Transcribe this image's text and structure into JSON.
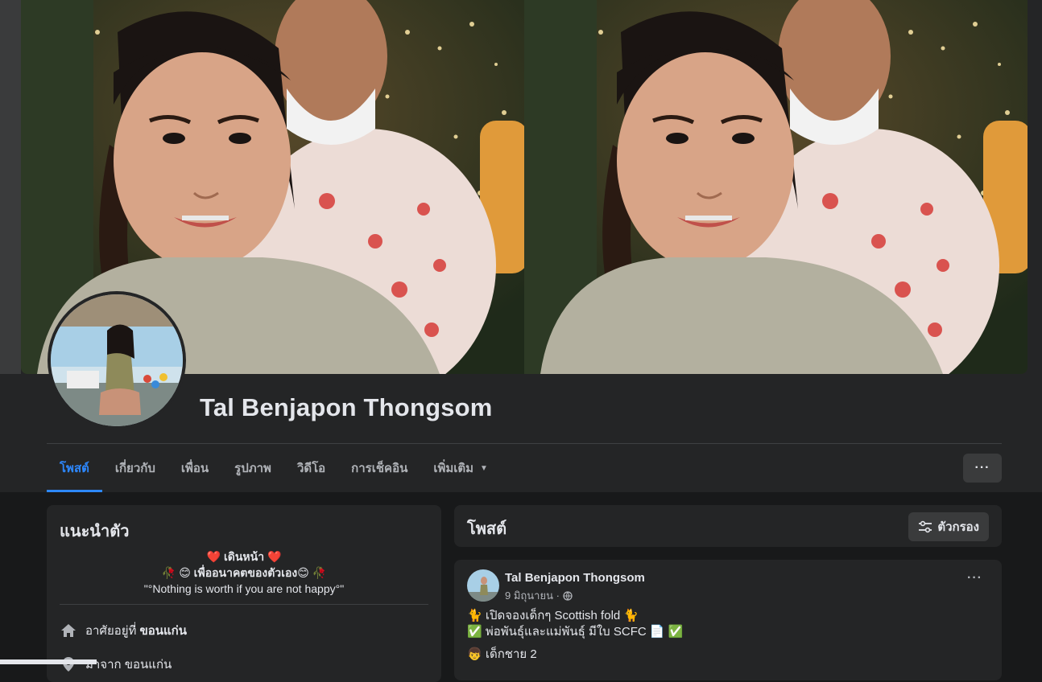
{
  "profile": {
    "name": "Tal Benjapon Thongsom"
  },
  "tabs": [
    {
      "label": "โพสต์",
      "active": true
    },
    {
      "label": "เกี่ยวกับ",
      "active": false
    },
    {
      "label": "เพื่อน",
      "active": false
    },
    {
      "label": "รูปภาพ",
      "active": false
    },
    {
      "label": "วิดีโอ",
      "active": false
    },
    {
      "label": "การเช็คอิน",
      "active": false
    },
    {
      "label": "เพิ่มเติม",
      "active": false
    }
  ],
  "more_button": {
    "label": "···"
  },
  "intro": {
    "title": "แนะนำตัว",
    "bio_line1": "❤️ เดินหน้า ❤️",
    "bio_line2": "🥀 😊 เพื่ออนาคตของตัวเอง😊 🥀",
    "bio_line3": "\"°Nothing is worth if you are not happy°\"",
    "lives_in_prefix": "อาศัยอยู่ที่",
    "lives_in_value": "ขอนแก่น",
    "from_partial": "มาจาก ขอนแก่น"
  },
  "posts_header": {
    "title": "โพสต์",
    "filter_label": "ตัวกรอง"
  },
  "post": {
    "author": "Tal Benjapon Thongsom",
    "date": "9 มิถุนายน ·",
    "more": "···",
    "line1": "🐈 เปิดจองเด็กๆ Scottish fold 🐈",
    "line2": "✅ พ่อพันธุ์และแม่พันธุ์ มีใบ SCFC 📄 ✅",
    "line3": "👦 เด็กชาย 2"
  },
  "colors": {
    "accent": "#2d88ff",
    "card": "#242526",
    "page": "#18191a",
    "text": "#e4e6eb",
    "muted": "#b0b3b8"
  }
}
